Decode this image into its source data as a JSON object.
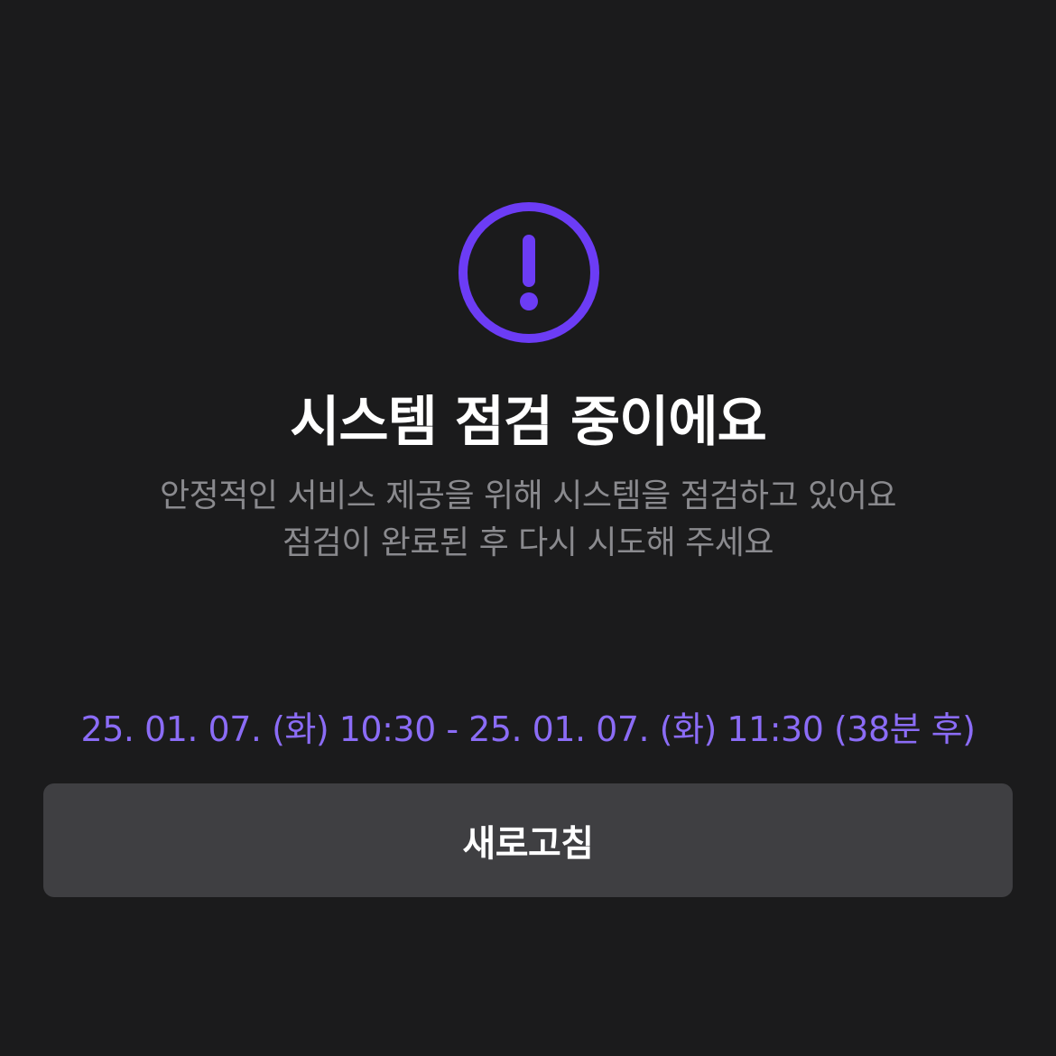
{
  "colors": {
    "background": "#1b1b1c",
    "accent": "#6c3cf5",
    "schedule_text": "#8b6cf6",
    "description_text": "#8a8a8e",
    "button_background": "#3f3f42"
  },
  "icon": {
    "name": "exclamation-circle-icon"
  },
  "title": "시스템 점검 중이에요",
  "description": {
    "line1": "안정적인 서비스 제공을 위해 시스템을 점검하고 있어요",
    "line2": "점검이 완료된 후 다시 시도해 주세요"
  },
  "schedule": "25. 01. 07. (화) 10:30 - 25. 01. 07. (화) 11:30 (38분 후)",
  "refresh_button": {
    "label": "새로고침"
  }
}
